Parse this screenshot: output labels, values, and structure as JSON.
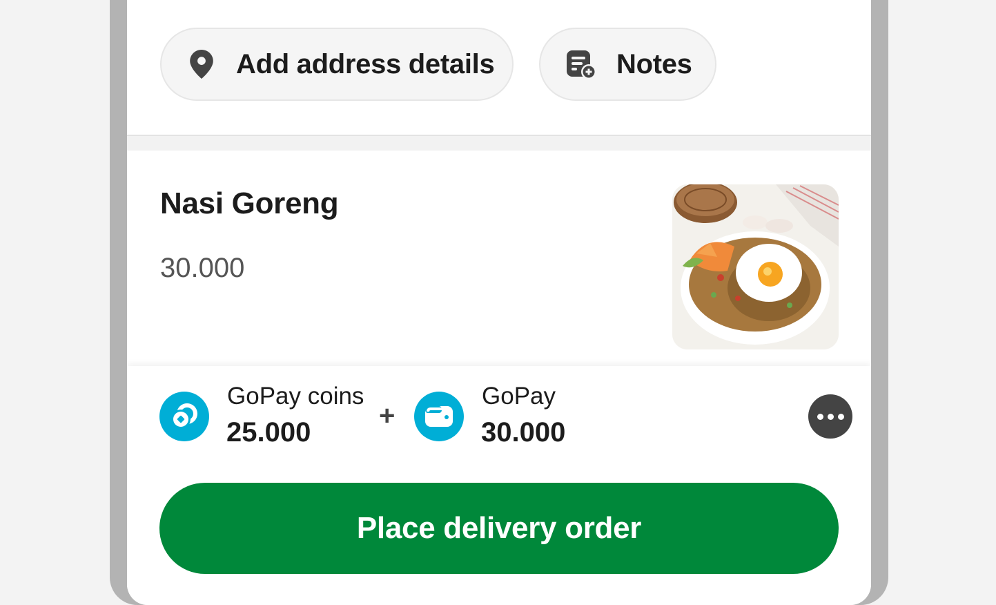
{
  "actions": {
    "address_label": "Add address details",
    "notes_label": "Notes"
  },
  "item": {
    "name": "Nasi Goreng",
    "price": "30.000"
  },
  "payment": {
    "coins_label": "GoPay coins",
    "coins_amount": "25.000",
    "plus": "+",
    "gopay_label": "GoPay",
    "gopay_amount": "30.000"
  },
  "cta": {
    "label": "Place delivery order"
  },
  "colors": {
    "primary_green": "#00883a",
    "gopay_blue": "#00aed6",
    "text_dark": "#1c1c1c"
  },
  "icons": {
    "address": "location-pin-icon",
    "notes": "notes-add-icon",
    "coins": "gopay-coins-icon",
    "wallet": "wallet-icon",
    "more": "more-options-icon"
  }
}
